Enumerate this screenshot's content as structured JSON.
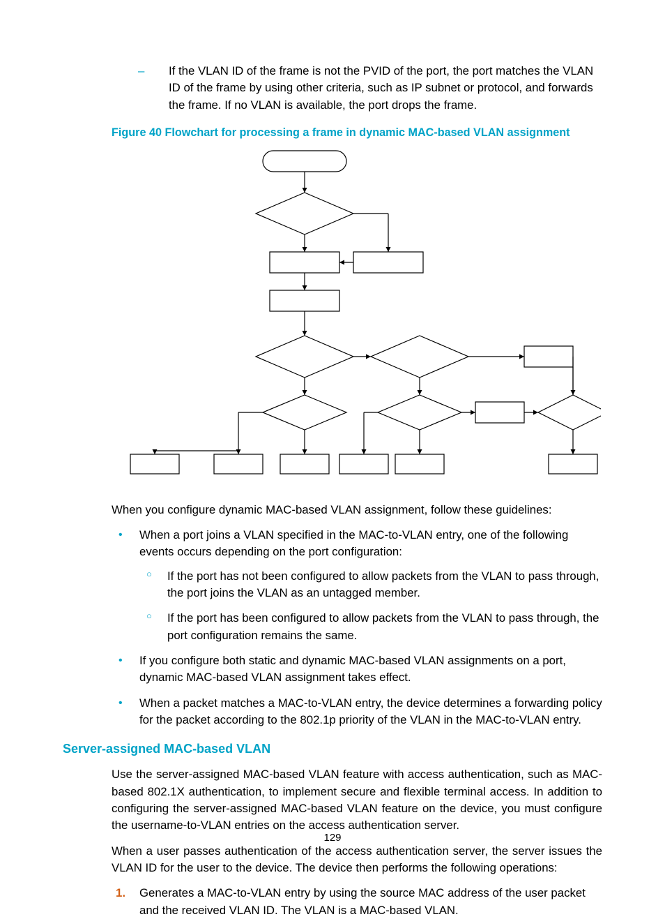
{
  "top_item": {
    "text": "If the VLAN ID of the frame is not the PVID of the port, the port matches the VLAN ID of the frame by using other criteria, such as IP subnet or protocol, and forwards the frame. If no VLAN is available, the port drops the frame."
  },
  "figure_caption": "Figure 40 Flowchart for processing a frame in dynamic MAC-based VLAN assignment",
  "intro_line": "When you configure dynamic MAC-based VLAN assignment, follow these guidelines:",
  "bullets": [
    {
      "text": "When a port joins a VLAN specified in the MAC-to-VLAN entry, one of the following events occurs depending on the port configuration:",
      "subs": [
        "If the port has not been configured to allow packets from the VLAN to pass through, the port joins the VLAN as an untagged member.",
        "If the port has been configured to allow packets from the VLAN to pass through, the port configuration remains the same."
      ]
    },
    {
      "text": "If you configure both static and dynamic MAC-based VLAN assignments on a port, dynamic MAC-based VLAN assignment takes effect."
    },
    {
      "text": "When a packet matches a MAC-to-VLAN entry, the device determines a forwarding policy for the packet according to the 802.1p priority of the VLAN in the MAC-to-VLAN entry."
    }
  ],
  "section_heading": "Server-assigned MAC-based VLAN",
  "section_paras": [
    "Use the server-assigned MAC-based VLAN feature with access authentication, such as MAC-based 802.1X authentication, to implement secure and flexible terminal access. In addition to configuring the server-assigned MAC-based VLAN feature on the device, you must configure the username-to-VLAN entries on the access authentication server.",
    "When a user passes authentication of the access authentication server, the server issues the VLAN ID for the user to the device. The device then performs the following operations:"
  ],
  "numbered": [
    {
      "n": "1.",
      "text": "Generates a MAC-to-VLAN entry by using the source MAC address of the user packet and the received VLAN ID. The VLAN is a MAC-based VLAN."
    }
  ],
  "page_number": "129"
}
